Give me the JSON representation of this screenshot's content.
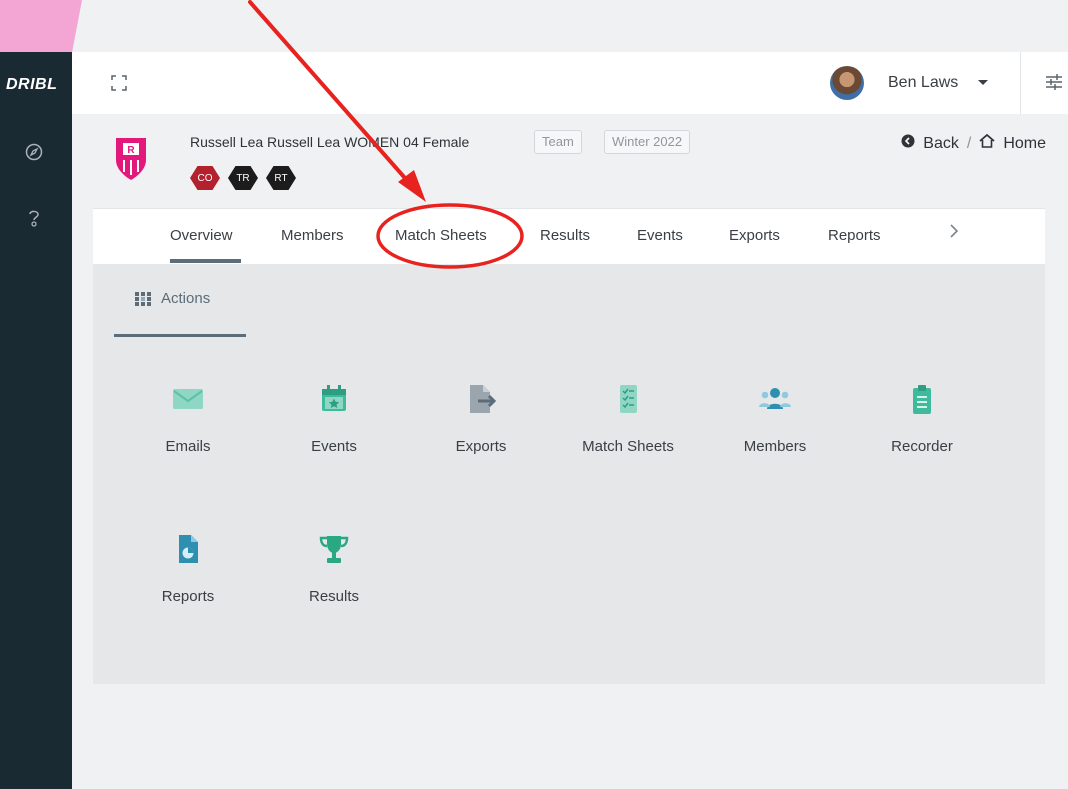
{
  "sidebar": {
    "logo": "DRIBL",
    "items": [
      {
        "icon": "compass-icon"
      },
      {
        "icon": "help-icon"
      }
    ]
  },
  "topbar": {
    "user_name": "Ben Laws"
  },
  "team": {
    "title": "Russell Lea Russell Lea WOMEN 04 Female",
    "tags": [
      "Team",
      "Winter 2022"
    ],
    "badges": [
      {
        "label": "CO",
        "color": "#b3202e"
      },
      {
        "label": "TR",
        "color": "#1c1c1c"
      },
      {
        "label": "RT",
        "color": "#1c1c1c"
      }
    ]
  },
  "breadcrumb": {
    "back": "Back",
    "home": "Home",
    "separator": "/"
  },
  "tabs": [
    {
      "label": "Overview",
      "active": true
    },
    {
      "label": "Members"
    },
    {
      "label": "Match Sheets"
    },
    {
      "label": "Results"
    },
    {
      "label": "Events"
    },
    {
      "label": "Exports"
    },
    {
      "label": "Reports"
    }
  ],
  "actions": {
    "title": "Actions",
    "items": [
      {
        "label": "Emails",
        "icon": "envelope-icon"
      },
      {
        "label": "Events",
        "icon": "calendar-star-icon"
      },
      {
        "label": "Exports",
        "icon": "file-export-icon"
      },
      {
        "label": "Match Sheets",
        "icon": "checklist-icon"
      },
      {
        "label": "Members",
        "icon": "users-icon"
      },
      {
        "label": "Recorder",
        "icon": "clipboard-icon"
      },
      {
        "label": "Reports",
        "icon": "file-chart-icon"
      },
      {
        "label": "Results",
        "icon": "trophy-icon"
      }
    ]
  },
  "colors": {
    "accent": "#3dbb9c",
    "sidebar": "#1a2a33",
    "annotation": "#e8231f"
  }
}
